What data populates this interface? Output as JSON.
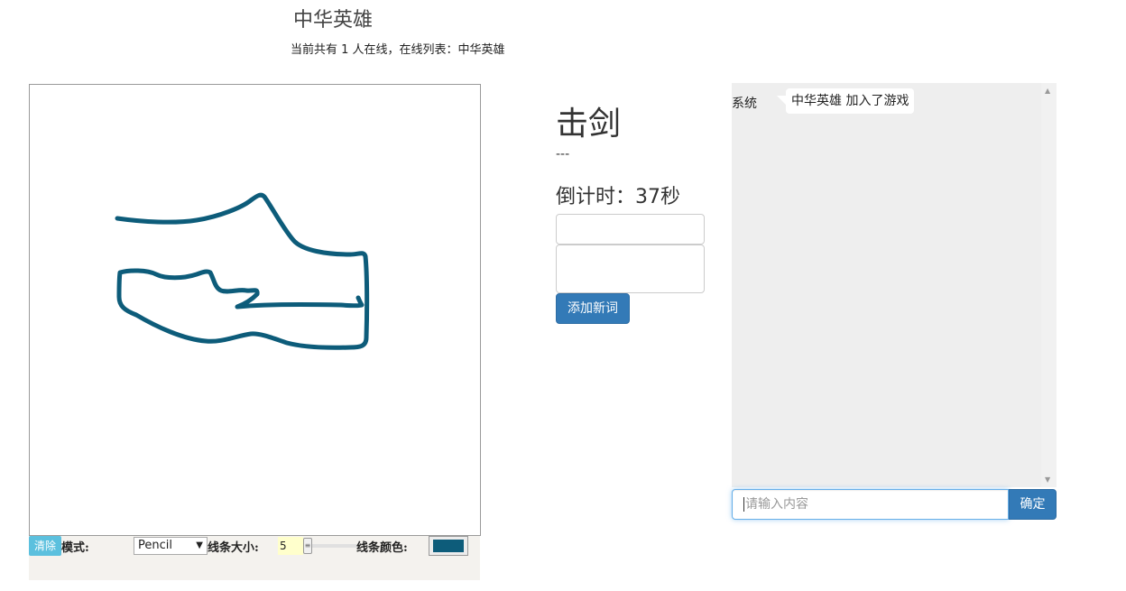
{
  "header": {
    "user_name": "中华英雄",
    "online_status": "当前共有 1 人在线，在线列表：中华英雄"
  },
  "toolbar": {
    "clear_label": "清除",
    "mode_label": "模式:",
    "mode_value": "Pencil",
    "line_size_label": "线条大小:",
    "line_size_value": "5",
    "line_color_label": "线条颜色:",
    "line_color": "#0d5c7a"
  },
  "game": {
    "word": "击剑",
    "hint": "---",
    "countdown": "倒计时：37秒",
    "add_word_label": "添加新词"
  },
  "chat": {
    "messages": [
      {
        "sender": "系统",
        "text": "中华英雄 加入了游戏"
      }
    ],
    "input_placeholder": "请输入内容",
    "send_label": "确定"
  },
  "colors": {
    "stroke": "#0d5c7a",
    "primary": "#337ab7",
    "info": "#5bc0de",
    "chat_bg": "#eeeeee"
  }
}
